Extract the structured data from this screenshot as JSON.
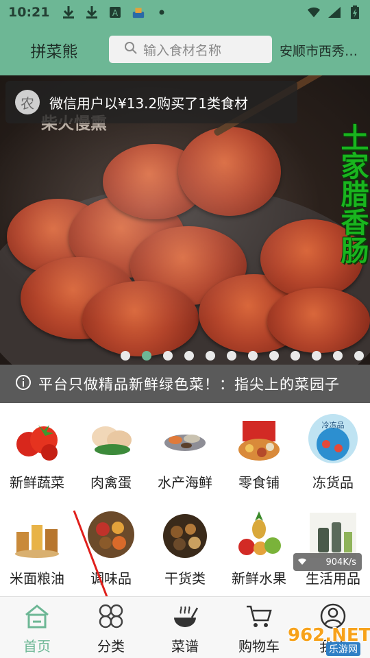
{
  "status_bar": {
    "time": "10:21"
  },
  "header": {
    "brand": "拼菜熊",
    "search_placeholder": "输入食材名称",
    "location": "安顺市西秀…"
  },
  "banner": {
    "toast_avatar": "农",
    "toast_message": "微信用户以¥13.2购买了1类食材",
    "vertical_text": "土家腊香肠",
    "left_text": "柴火慢熏",
    "slide_count": 12,
    "active_slide_index": 1
  },
  "notice": {
    "text": "平台只做精品新鲜绿色菜！：指尖上的菜园子"
  },
  "categories": [
    {
      "label": "新鲜蔬菜",
      "icon": "tomato-icon"
    },
    {
      "label": "肉禽蛋",
      "icon": "chicken-icon"
    },
    {
      "label": "水产海鲜",
      "icon": "seafood-icon"
    },
    {
      "label": "零食铺",
      "icon": "snack-icon"
    },
    {
      "label": "冻货品",
      "icon": "frozen-icon",
      "badge": "冷冻品"
    },
    {
      "label": "米面粮油",
      "icon": "grain-icon"
    },
    {
      "label": "调味品",
      "icon": "spice-icon"
    },
    {
      "label": "干货类",
      "icon": "dried-goods-icon"
    },
    {
      "label": "新鲜水果",
      "icon": "fruit-icon"
    },
    {
      "label": "生活用品",
      "icon": "household-icon"
    }
  ],
  "network_speed": "904K/s",
  "bottom_nav": [
    {
      "label": "首页",
      "icon": "home-icon",
      "active": true
    },
    {
      "label": "分类",
      "icon": "category-icon",
      "active": false
    },
    {
      "label": "菜谱",
      "icon": "recipe-icon",
      "active": false
    },
    {
      "label": "购物车",
      "icon": "cart-icon",
      "active": false
    },
    {
      "label": "我的",
      "icon": "user-icon",
      "active": false
    }
  ],
  "watermark": {
    "brand": "962.NET",
    "sub": "乐游网"
  },
  "colors": {
    "primary": "#6db795",
    "notice_bg": "#5a5a5a",
    "banner_text": "#19b51e"
  }
}
